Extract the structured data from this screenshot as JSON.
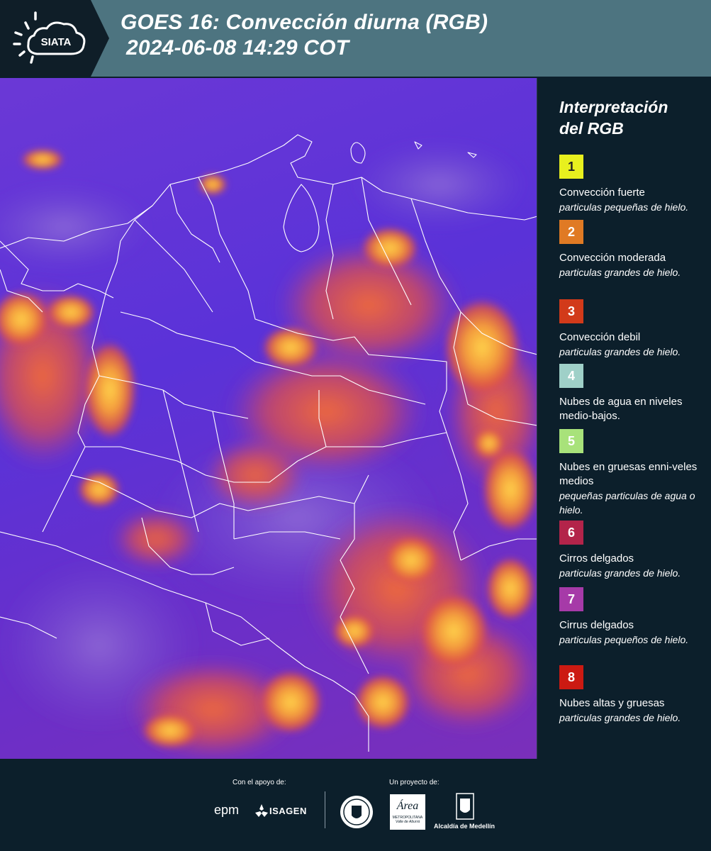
{
  "header": {
    "logo_text": "SIATA",
    "title_line1": "GOES 16: Convección diurna (RGB)",
    "title_line2": "2024-06-08 14:29 COT"
  },
  "legend": {
    "title_line1": "Interpretación",
    "title_line2": "del RGB",
    "items": [
      {
        "num": "1",
        "color": "#e8f01e",
        "text_color": "#222222",
        "name": "Convección fuerte",
        "sub": "particulas pequeñas de hielo."
      },
      {
        "num": "2",
        "color": "#e07a24",
        "text_color": "#ffffff",
        "name": "Convección moderada",
        "sub": "particulas grandes de hielo."
      },
      {
        "num": "3",
        "color": "#d23a1a",
        "text_color": "#ffffff",
        "name": "Convección debil",
        "sub": "particulas grandes de hielo."
      },
      {
        "num": "4",
        "color": "#9fd0c8",
        "text_color": "#ffffff",
        "name": "Nubes de agua en niveles medio-bajos.",
        "sub": ""
      },
      {
        "num": "5",
        "color": "#a8e27a",
        "text_color": "#ffffff",
        "name": "Nubes en gruesas enni-veles medios",
        "sub": "pequeñas particulas de agua o hielo."
      },
      {
        "num": "6",
        "color": "#b3244a",
        "text_color": "#ffffff",
        "name": "Cirros delgados",
        "sub": "particulas grandes de hielo."
      },
      {
        "num": "7",
        "color": "#a63aa8",
        "text_color": "#ffffff",
        "name": "Cirrus delgados",
        "sub": "particulas pequeños de hielo."
      },
      {
        "num": "8",
        "color": "#cc1a12",
        "text_color": "#ffffff",
        "name": "Nubes altas y gruesas",
        "sub": "particulas grandes de hielo."
      }
    ]
  },
  "footer": {
    "support_label": "Con el apoyo de:",
    "project_label": "Un proyecto de:",
    "epm_text": "epm",
    "isagen_text": "ISAGEN",
    "area_text": "Área",
    "area_sub": "METROPOLITANA",
    "area_sub2": "Valle de Aburrá",
    "alcaldia_text": "Alcaldía de Medellín"
  },
  "map": {
    "background_color": "#5b33d6",
    "border_color": "#ffffff",
    "cloud_colors": {
      "strong": "#f7c64a",
      "moderate": "#f08a3a",
      "weak": "#e2533a"
    }
  }
}
